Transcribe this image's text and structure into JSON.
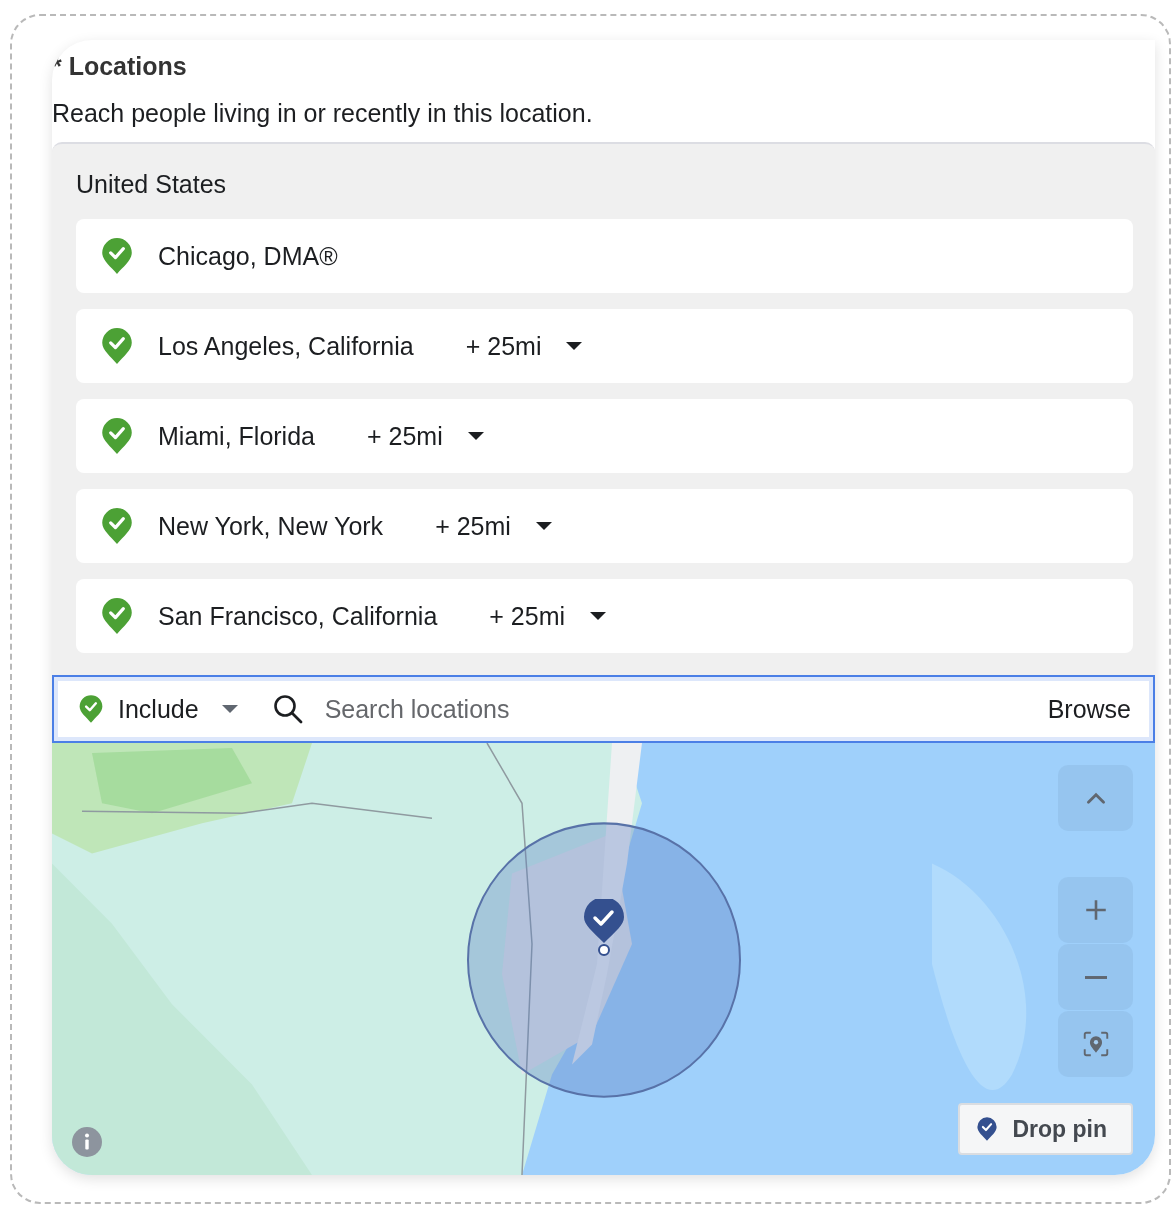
{
  "section": {
    "title": "* Locations",
    "description": "Reach people living in or recently in this location."
  },
  "country": "United States",
  "locations": [
    {
      "name": "Chicago, DMA®"
    },
    {
      "name": "Los Angeles, California",
      "radius": "+ 25mi"
    },
    {
      "name": "Miami, Florida",
      "radius": "+ 25mi"
    },
    {
      "name": "New York, New York",
      "radius": "+ 25mi"
    },
    {
      "name": "San Francisco, California",
      "radius": "+ 25mi"
    }
  ],
  "search_bar": {
    "mode": "Include",
    "placeholder": "Search locations",
    "browse": "Browse"
  },
  "map": {
    "kind": "picture",
    "drop_pin": "Drop pin"
  }
}
